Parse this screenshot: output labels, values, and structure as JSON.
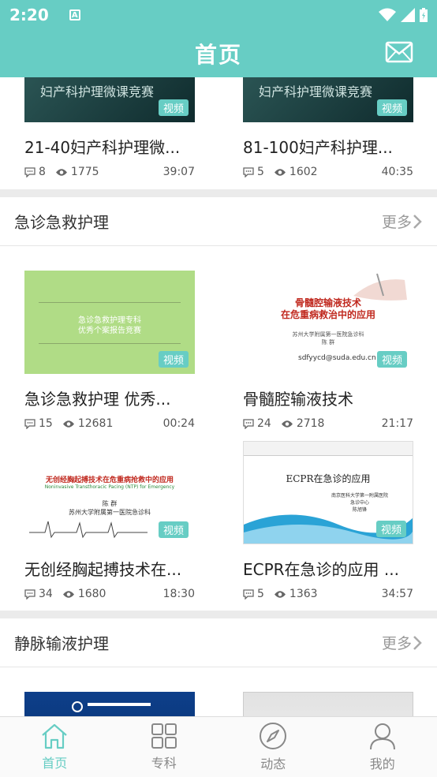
{
  "status_bar": {
    "time": "2:20"
  },
  "header": {
    "title": "首页"
  },
  "sections": [
    {
      "cards": [
        {
          "title": "21-40妇产科护理微...",
          "thumb_text": "妇产科护理微课竞赛",
          "tag": "视频",
          "comments": "8",
          "views": "1775",
          "duration": "39:07"
        },
        {
          "title": "81-100妇产科护理...",
          "thumb_text": "妇产科护理微课竞赛",
          "tag": "视频",
          "comments": "5",
          "views": "1602",
          "duration": "40:35"
        }
      ]
    },
    {
      "title": "急诊急救护理",
      "more": "更多",
      "cards": [
        {
          "title": "急诊急救护理 优秀...",
          "thumb_lines": [
            "急诊急救护理专科",
            "优秀个案报告竞赛"
          ],
          "tag": "视频",
          "comments": "15",
          "views": "12681",
          "duration": "00:24"
        },
        {
          "title": "骨髓腔输液技术",
          "thumb_lines": [
            "骨髓腔输液技术",
            "在危重病救治中的应用",
            "苏州大学附属第一医院急诊科",
            "陈 群",
            "sdfyycd@suda.edu.cn"
          ],
          "tag": "视频",
          "comments": "24",
          "views": "2718",
          "duration": "21:17"
        },
        {
          "title": "无创经胸起搏技术在...",
          "thumb_lines": [
            "无创经胸起搏技术在危重病抢救中的应用",
            "Noninvasive Transthoracic Pacing (NTP) for Emergency",
            "陈 群",
            "苏州大学附属第一医院急诊科"
          ],
          "tag": "视频",
          "comments": "34",
          "views": "1680",
          "duration": "18:30"
        },
        {
          "title": "ECPR在急诊的应用 ...",
          "thumb_lines": [
            "ECPR在急诊的应用",
            "南京医科大学第一附属医院",
            "急诊中心",
            "陈旭锋"
          ],
          "tag": "视频",
          "comments": "5",
          "views": "1363",
          "duration": "34:57"
        }
      ]
    },
    {
      "title": "静脉输液护理",
      "more": "更多"
    }
  ],
  "tabs": [
    {
      "label": "首页",
      "icon": "home-icon",
      "active": true
    },
    {
      "label": "专科",
      "icon": "grid-icon",
      "active": false
    },
    {
      "label": "动态",
      "icon": "compass-icon",
      "active": false
    },
    {
      "label": "我的",
      "icon": "person-icon",
      "active": false
    }
  ],
  "colors": {
    "accent": "#67cdc4",
    "separator": "#ebebeb"
  }
}
